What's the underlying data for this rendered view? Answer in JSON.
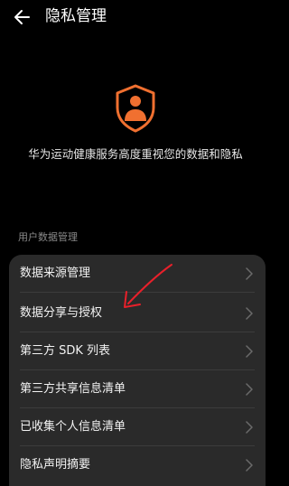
{
  "header": {
    "title": "隐私管理"
  },
  "intro": {
    "text": "华为运动健康服务高度重视您的数据和隐私"
  },
  "section": {
    "label": "用户数据管理"
  },
  "menu": {
    "items": [
      {
        "label": "数据来源管理"
      },
      {
        "label": "数据分享与授权"
      },
      {
        "label": "第三方 SDK 列表"
      },
      {
        "label": "第三方共享信息清单"
      },
      {
        "label": "已收集个人信息清单"
      },
      {
        "label": "隐私声明摘要"
      }
    ]
  },
  "colors": {
    "accent": "#f07030",
    "annotation": "#e8202a",
    "background": "#000000",
    "card": "#2a2a2a"
  }
}
